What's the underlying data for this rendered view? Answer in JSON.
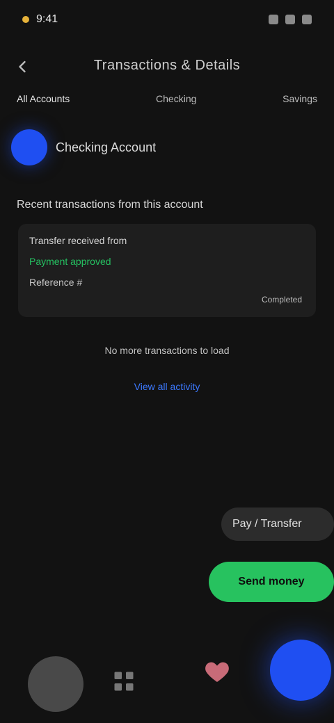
{
  "status": {
    "time": "9:41"
  },
  "header": {
    "title": "Transactions & Details"
  },
  "tabs": [
    {
      "label": "All Accounts"
    },
    {
      "label": "Checking"
    },
    {
      "label": "Savings"
    }
  ],
  "account": {
    "name": "Checking Account"
  },
  "section": {
    "heading": "Recent transactions from this account"
  },
  "card": {
    "line1": "Transfer received from",
    "line2": "Payment approved",
    "line3": "Reference #",
    "meta": "Completed"
  },
  "note": "No more transactions to load",
  "link": "View all activity",
  "pill": "Pay / Transfer",
  "cta": "Send money",
  "colors": {
    "accent": "#1f4ff2",
    "success": "#27c25f"
  }
}
